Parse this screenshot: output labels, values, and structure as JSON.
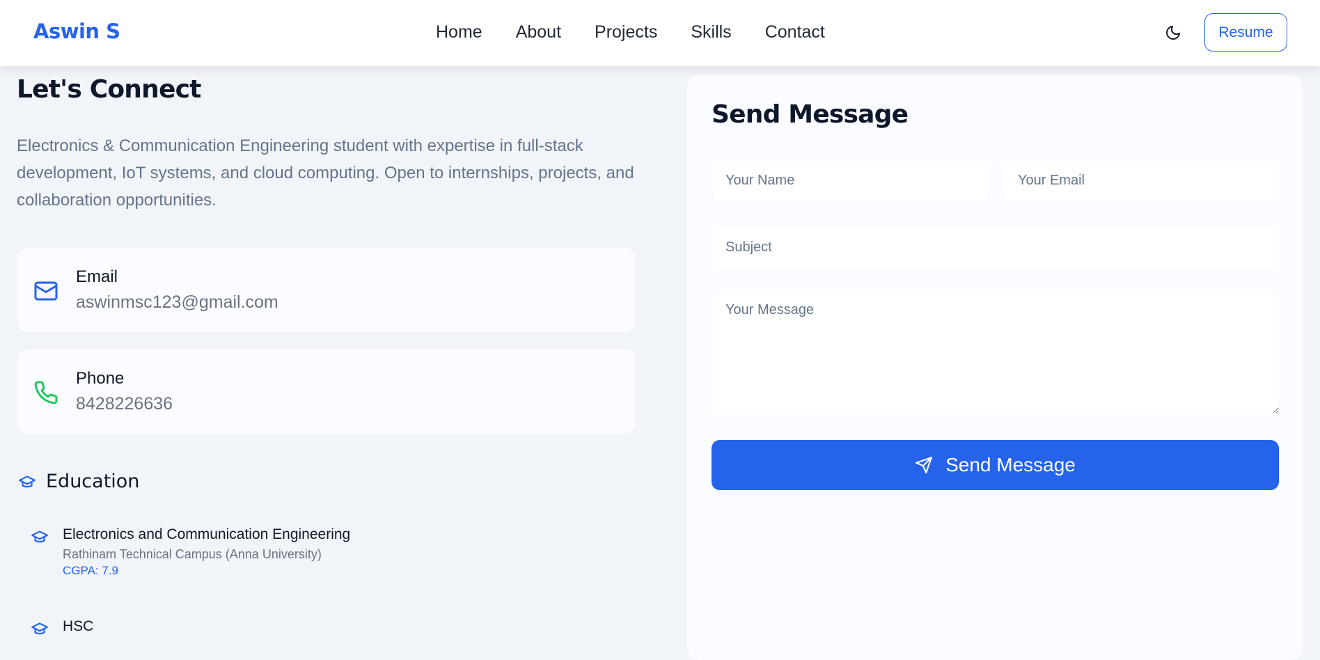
{
  "navbar": {
    "brand": "Aswin S",
    "links": [
      "Home",
      "About",
      "Projects",
      "Skills",
      "Contact"
    ],
    "theme_toggle_icon": "moon-icon",
    "resume_label": "Resume"
  },
  "connect": {
    "title": "Let's Connect",
    "intro": "Electronics & Communication Engineering student with expertise in full-stack development, IoT systems, and cloud computing. Open to internships, projects, and collaboration opportunities.",
    "contacts": [
      {
        "label": "Email",
        "value": "aswinmsc123@gmail.com",
        "icon": "mail-icon",
        "color": "#2563eb"
      },
      {
        "label": "Phone",
        "value": "8428226636",
        "icon": "phone-icon",
        "color": "#22c55e"
      }
    ]
  },
  "education": {
    "heading": "Education",
    "items": [
      {
        "degree": "Electronics and Communication Engineering",
        "school": "Rathinam Technical Campus (Anna University)",
        "grade": "CGPA: 7.9"
      },
      {
        "degree": "HSC",
        "school": "",
        "grade": ""
      }
    ]
  },
  "form": {
    "title": "Send Message",
    "name_placeholder": "Your Name",
    "email_placeholder": "Your Email",
    "subject_placeholder": "Subject",
    "message_placeholder": "Your Message",
    "submit_label": "Send Message",
    "submit_icon": "send-icon"
  },
  "colors": {
    "accent": "#2563eb",
    "background": "#f1f4f8",
    "card": "#fafcff",
    "phone_icon": "#22c55e"
  }
}
